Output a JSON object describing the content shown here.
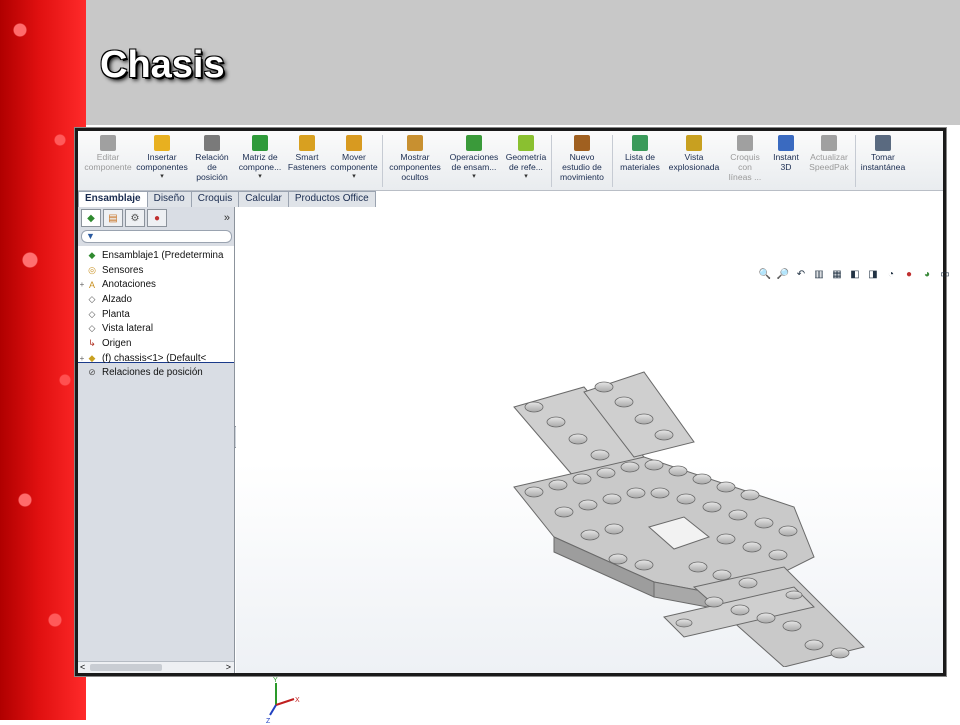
{
  "slide": {
    "title": "Chasis"
  },
  "ribbon": {
    "buttons": [
      {
        "label1": "Editar",
        "label2": "componente",
        "label3": "",
        "arrow": false,
        "disabled": true,
        "icon": "edit-component-icon",
        "color": "#a0a0a0"
      },
      {
        "label1": "Insertar",
        "label2": "componentes",
        "label3": "",
        "arrow": true,
        "disabled": false,
        "icon": "insert-components-icon",
        "color": "#e8b020"
      },
      {
        "label1": "Relación",
        "label2": "de",
        "label3": "posición",
        "arrow": false,
        "disabled": false,
        "icon": "mate-icon",
        "color": "#7a7a7a"
      },
      {
        "label1": "Matriz de",
        "label2": "compone...",
        "label3": "",
        "arrow": true,
        "disabled": false,
        "icon": "pattern-icon",
        "color": "#2f9a3a"
      },
      {
        "label1": "Smart",
        "label2": "Fasteners",
        "label3": "",
        "arrow": false,
        "disabled": false,
        "icon": "smart-fasteners-icon",
        "color": "#d8a020"
      },
      {
        "label1": "Mover",
        "label2": "componente",
        "label3": "",
        "arrow": true,
        "disabled": false,
        "icon": "move-component-icon",
        "color": "#d89a20"
      },
      {
        "label1": "Mostrar",
        "label2": "componentes",
        "label3": "ocultos",
        "arrow": false,
        "disabled": false,
        "icon": "show-hidden-icon",
        "color": "#c89030"
      },
      {
        "label1": "Operaciones",
        "label2": "de ensam...",
        "label3": "",
        "arrow": true,
        "disabled": false,
        "icon": "assembly-features-icon",
        "color": "#3a9a3a"
      },
      {
        "label1": "Geometría",
        "label2": "de refe...",
        "label3": "",
        "arrow": true,
        "disabled": false,
        "icon": "reference-geometry-icon",
        "color": "#8ac030"
      },
      {
        "label1": "Nuevo",
        "label2": "estudio de",
        "label3": "movimiento",
        "arrow": false,
        "disabled": false,
        "icon": "motion-study-icon",
        "color": "#a06020"
      },
      {
        "label1": "Lista de",
        "label2": "materiales",
        "label3": "",
        "arrow": false,
        "disabled": false,
        "icon": "bom-icon",
        "color": "#3a9a5a"
      },
      {
        "label1": "Vista",
        "label2": "explosionada",
        "label3": "",
        "arrow": false,
        "disabled": false,
        "icon": "exploded-view-icon",
        "color": "#c8a020"
      },
      {
        "label1": "Croquis",
        "label2": "con",
        "label3": "líneas ...",
        "arrow": false,
        "disabled": true,
        "icon": "explode-line-sketch-icon",
        "color": "#a0a0a0"
      },
      {
        "label1": "Instant",
        "label2": "3D",
        "label3": "",
        "arrow": false,
        "disabled": false,
        "icon": "instant3d-icon",
        "color": "#3a6ac0"
      },
      {
        "label1": "Actualizar",
        "label2": "SpeedPak",
        "label3": "",
        "arrow": false,
        "disabled": true,
        "icon": "speedpak-icon",
        "color": "#a0a0a0"
      },
      {
        "label1": "Tomar",
        "label2": "instantánea",
        "label3": "",
        "arrow": false,
        "disabled": false,
        "icon": "snapshot-icon",
        "color": "#5a6a80"
      }
    ]
  },
  "tabs": [
    {
      "label": "Ensamblaje",
      "active": true
    },
    {
      "label": "Diseño",
      "active": false
    },
    {
      "label": "Croquis",
      "active": false
    },
    {
      "label": "Calcular",
      "active": false
    },
    {
      "label": "Productos Office",
      "active": false
    }
  ],
  "panel": {
    "more": "»",
    "filter": "▼",
    "tree": [
      {
        "label": "Ensamblaje1  (Predetermina",
        "icon": "assembly-icon",
        "expander": "",
        "glyph": "◆",
        "color": "#2f8a2f"
      },
      {
        "label": "Sensores",
        "icon": "sensors-icon",
        "expander": "",
        "glyph": "◎",
        "color": "#c89020"
      },
      {
        "label": "Anotaciones",
        "icon": "annotations-icon",
        "expander": "+",
        "glyph": "A",
        "color": "#c89020"
      },
      {
        "label": "Alzado",
        "icon": "plane-icon",
        "expander": "",
        "glyph": "◇",
        "color": "#555555"
      },
      {
        "label": "Planta",
        "icon": "plane-icon",
        "expander": "",
        "glyph": "◇",
        "color": "#555555"
      },
      {
        "label": "Vista lateral",
        "icon": "plane-icon",
        "expander": "",
        "glyph": "◇",
        "color": "#555555"
      },
      {
        "label": "Origen",
        "icon": "origin-icon",
        "expander": "",
        "glyph": "↳",
        "color": "#b03020"
      },
      {
        "label": "(f) chassis<1> (Default<",
        "icon": "part-icon",
        "expander": "+",
        "glyph": "◆",
        "color": "#c8a020"
      },
      {
        "label": "Relaciones de posición",
        "icon": "mates-icon",
        "expander": "",
        "glyph": "⊘",
        "color": "#555555"
      }
    ],
    "scroll_left": "<",
    "scroll_right": ">"
  },
  "viewport": {
    "triad": {
      "x": "X",
      "y": "Y",
      "z": "Z"
    }
  }
}
